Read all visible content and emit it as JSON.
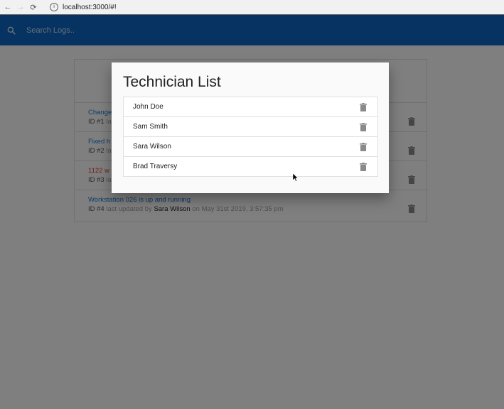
{
  "browser": {
    "url": "localhost:3000/#!",
    "back_glyph": "←",
    "forward_glyph": "→",
    "reload_glyph": "⟳",
    "info_glyph": "i"
  },
  "navbar": {
    "search_placeholder": "Search Logs..",
    "color": "#0d66c2",
    "search_icon": "search-icon"
  },
  "logs": [
    {
      "message": "Changed",
      "id_label": "ID #1",
      "meta": "last",
      "attention": false
    },
    {
      "message": "Fixed h",
      "id_label": "ID #2",
      "meta": "la",
      "attention": false
    },
    {
      "message": "1122 w",
      "id_label": "ID #3",
      "meta": "la",
      "attention": true
    },
    {
      "message": "Workstation 026 is up and running",
      "id_label": "ID #4",
      "meta": "last updated by",
      "tech": "Sara Wilson",
      "date": "on May 31st 2019, 3:57:35 pm",
      "attention": false
    }
  ],
  "modal": {
    "title": "Technician List",
    "technicians": [
      {
        "name": "John Doe"
      },
      {
        "name": "Sam Smith"
      },
      {
        "name": "Sara Wilson"
      },
      {
        "name": "Brad Traversy"
      }
    ],
    "delete_icon": "trash-icon"
  },
  "colors": {
    "link": "#1976d2",
    "attention": "#e53935",
    "icon_gray": "#8a8a8a"
  }
}
